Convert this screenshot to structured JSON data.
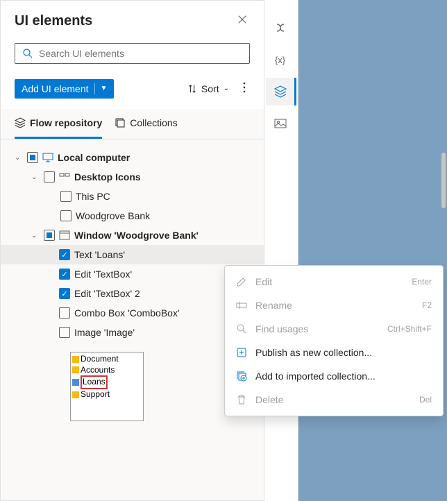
{
  "header": {
    "title": "UI elements"
  },
  "search": {
    "placeholder": "Search UI elements"
  },
  "toolbar": {
    "add_label": "Add UI element",
    "sort_label": "Sort"
  },
  "tabs": {
    "flow": "Flow repository",
    "collections": "Collections"
  },
  "tree": {
    "root": "Local computer",
    "desktop_icons": "Desktop Icons",
    "this_pc": "This PC",
    "woodgrove": "Woodgrove Bank",
    "window": "Window 'Woodgrove Bank'",
    "text_loans": "Text 'Loans'",
    "edit_tb": "Edit 'TextBox'",
    "edit_tb2": "Edit 'TextBox' 2",
    "combo": "Combo Box 'ComboBox'",
    "image": "Image 'Image'"
  },
  "preview": {
    "l1": "Document",
    "l2": "Accounts",
    "l3": "Loans",
    "l4": "Support"
  },
  "ctx": {
    "edit": "Edit",
    "edit_sc": "Enter",
    "rename": "Rename",
    "rename_sc": "F2",
    "find": "Find usages",
    "find_sc": "Ctrl+Shift+F",
    "publish": "Publish as new collection...",
    "add_imported": "Add to imported collection...",
    "delete": "Delete",
    "delete_sc": "Del"
  }
}
